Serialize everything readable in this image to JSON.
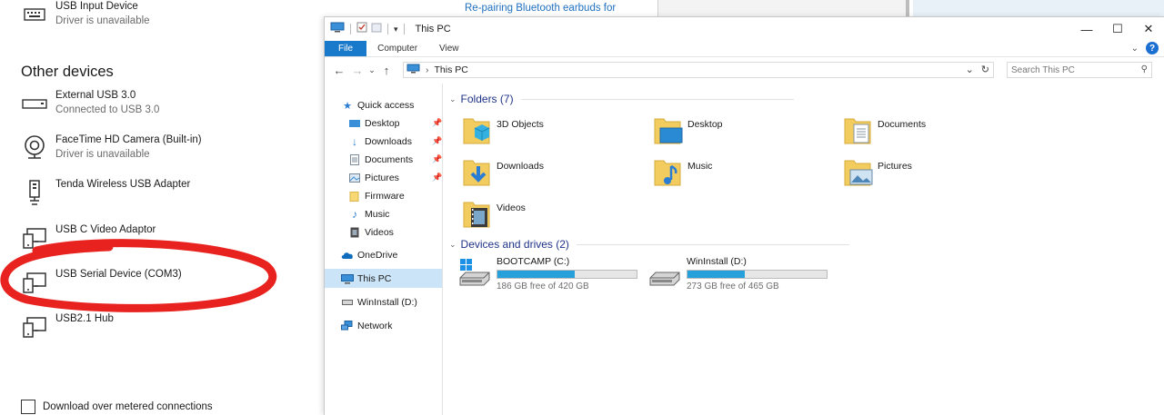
{
  "settings": {
    "usb_input": {
      "name": "USB Input Device",
      "status": "Driver is unavailable"
    },
    "other_devices_title": "Other devices",
    "devices": [
      {
        "name": "External USB 3.0",
        "status": "Connected to USB 3.0",
        "icon": "drive-icon"
      },
      {
        "name": "FaceTime HD Camera (Built-in)",
        "status": "Driver is unavailable",
        "icon": "webcam-icon"
      },
      {
        "name": "Tenda Wireless USB Adapter",
        "status": "",
        "icon": "usb-adapter-icon"
      },
      {
        "name": "USB C Video Adaptor",
        "status": "",
        "icon": "device-icon"
      },
      {
        "name": "USB Serial Device (COM3)",
        "status": "",
        "icon": "device-icon"
      },
      {
        "name": "USB2.1 Hub",
        "status": "",
        "icon": "device-icon"
      }
    ],
    "metered_label": "Download over metered connections",
    "highlight_color": "#e8231f"
  },
  "background": {
    "web_link": "Re-pairing Bluetooth earbuds for"
  },
  "explorer": {
    "title": "This PC",
    "controls": {
      "minimize": "—",
      "maximize": "☐",
      "close": "✕"
    },
    "ribbon_tabs": [
      "File",
      "Computer",
      "View"
    ],
    "address": {
      "location": "This PC",
      "separator": "›"
    },
    "search_placeholder": "Search This PC",
    "nav": {
      "quick_access": "Quick access",
      "pinned": [
        {
          "label": "Desktop",
          "pinned": true
        },
        {
          "label": "Downloads",
          "pinned": true
        },
        {
          "label": "Documents",
          "pinned": true
        },
        {
          "label": "Pictures",
          "pinned": true
        },
        {
          "label": "Firmware",
          "pinned": false
        },
        {
          "label": "Music",
          "pinned": false
        },
        {
          "label": "Videos",
          "pinned": false
        }
      ],
      "onedrive": "OneDrive",
      "this_pc": "This PC",
      "wininstall": "WinInstall (D:)",
      "network": "Network"
    },
    "folders_header": "Folders (7)",
    "folders": [
      "3D Objects",
      "Desktop",
      "Documents",
      "Downloads",
      "Music",
      "Pictures",
      "Videos"
    ],
    "drives_header": "Devices and drives (2)",
    "drives": [
      {
        "name": "BOOTCAMP (C:)",
        "free": "186 GB free of 420 GB",
        "used_fraction": 0.557
      },
      {
        "name": "WinInstall (D:)",
        "free": "273 GB free of 465 GB",
        "used_fraction": 0.413
      }
    ],
    "accent": "#1979ca"
  }
}
